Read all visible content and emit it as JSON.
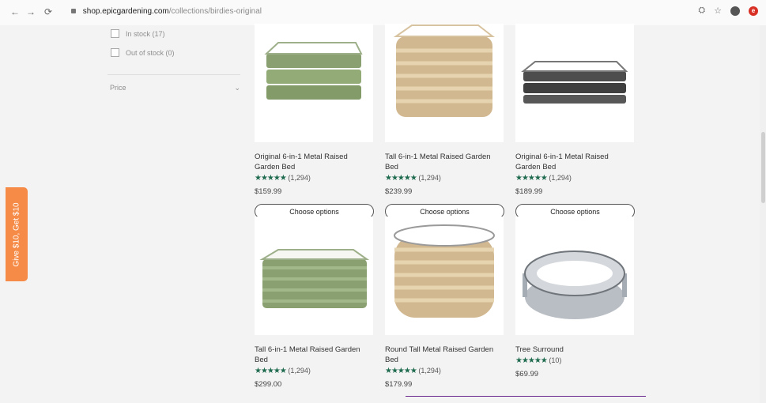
{
  "browser": {
    "back": "←",
    "forward": "→",
    "reload": "⟳",
    "domain": "shop.epicgardening.com",
    "path": "/collections/birdies-original",
    "translate": "⛭",
    "bookmark": "☆",
    "profile": "",
    "extension": "e"
  },
  "filters": {
    "in_stock": "In stock (17)",
    "out_of_stock": "Out of stock (0)",
    "price": "Price",
    "chevron": "⌄"
  },
  "promo": {
    "text": "Give $10, Get $10"
  },
  "products": [
    {
      "title": "Original 6-in-1 Metal Raised Garden Bed",
      "rating_stars": "★★★★★",
      "review_count": "(1,294)",
      "price": "$159.99",
      "button": "Choose options",
      "image": "green-low-bed",
      "color": "#8aa070"
    },
    {
      "title": "Tall 6-in-1 Metal Raised Garden Bed",
      "rating_stars": "★★★★★",
      "review_count": "(1,294)",
      "price": "$239.99",
      "button": "Choose options",
      "image": "tan-tall-bed",
      "color": "#d1b890"
    },
    {
      "title": "Original 6-in-1 Metal Raised Garden Bed",
      "rating_stars": "★★★★★",
      "review_count": "(1,294)",
      "price": "$189.99",
      "button": "Choose options",
      "image": "dark-low-bed",
      "color": "#4d4d4d"
    },
    {
      "title": "Tall 6-in-1 Metal Raised Garden Bed",
      "rating_stars": "★★★★★",
      "review_count": "(1,294)",
      "price": "$299.00",
      "image": "green-tall-bed",
      "color": "#8aa070"
    },
    {
      "title": "Round Tall Metal Raised Garden Bed",
      "rating_stars": "★★★★★",
      "review_count": "(1,294)",
      "price": "$179.99",
      "image": "tan-round-bed",
      "color": "#d1b890"
    },
    {
      "title": "Tree Surround",
      "rating_stars": "★★★★★",
      "review_count": "(10)",
      "price": "$69.99",
      "image": "silver-round-ring",
      "color": "#b9bec4"
    }
  ]
}
